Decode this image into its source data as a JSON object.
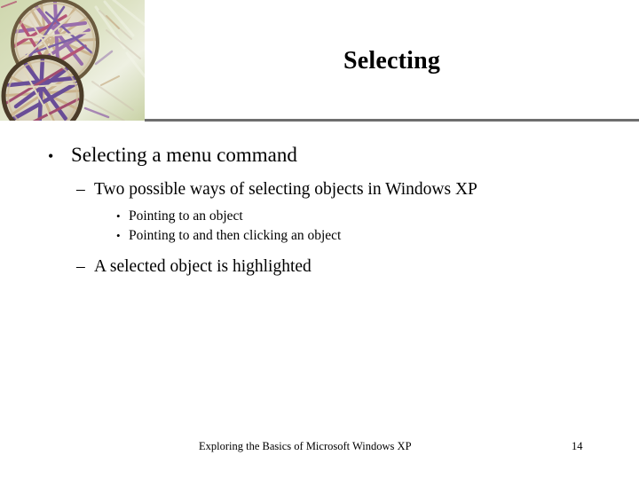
{
  "slide": {
    "title": "Selecting",
    "decor_image_name": "woven-plates-photo",
    "rule_color": "#6e6e6e",
    "background_color": "#ffffff",
    "text_color": "#000000"
  },
  "bullets": {
    "marks": {
      "level1": "•",
      "level2": "–",
      "level3": "•"
    },
    "items": [
      {
        "level": 1,
        "text": "Selecting a menu command"
      },
      {
        "level": 2,
        "text": "Two possible ways of selecting objects in Windows XP"
      },
      {
        "level": 3,
        "text": "Pointing to an object"
      },
      {
        "level": 3,
        "text": "Pointing to and then clicking an object"
      },
      {
        "level": 2,
        "text": "A selected object is highlighted"
      }
    ]
  },
  "footer": {
    "text": "Exploring the Basics of Microsoft Windows XP",
    "page_number": "14"
  }
}
